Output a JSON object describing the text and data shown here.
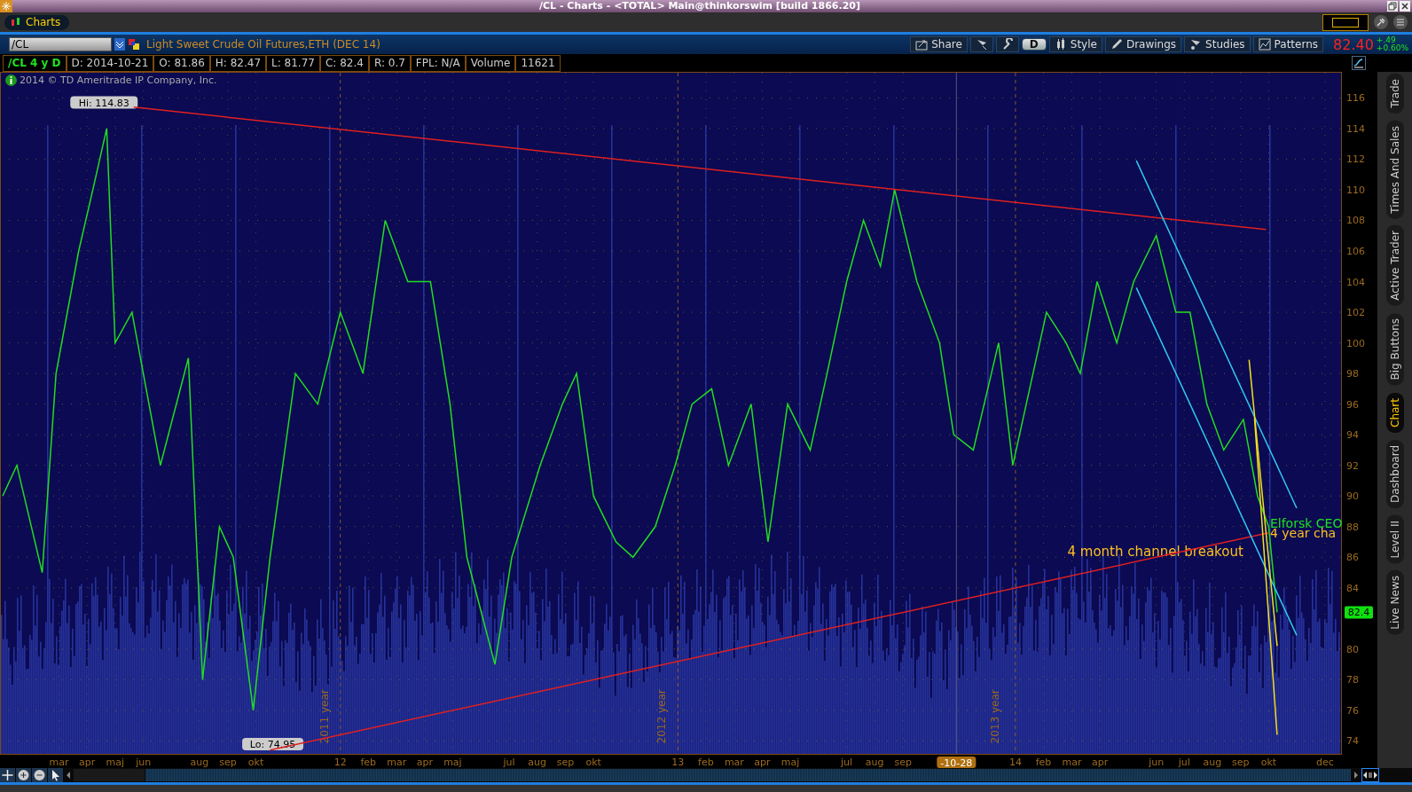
{
  "window": {
    "title": "/CL - Charts - <TOTAL> Main@thinkorswim [build 1866.20]"
  },
  "tabs": [
    {
      "label": "Charts",
      "selected": true
    }
  ],
  "symbol": {
    "value": "/CL",
    "description": "Light Sweet Crude Oil Futures,ETH (DEC 14)"
  },
  "toolbar": [
    {
      "kind": "labeled",
      "label": "Share"
    },
    {
      "kind": "icon"
    },
    {
      "kind": "icon"
    },
    {
      "kind": "period",
      "label": "D"
    },
    {
      "kind": "labeled",
      "label": "Style"
    },
    {
      "kind": "labeled",
      "label": "Drawings"
    },
    {
      "kind": "labeled",
      "label": "Studies"
    },
    {
      "kind": "labeled",
      "label": "Patterns"
    }
  ],
  "quote": {
    "last": "82.40",
    "change": "+.49",
    "change_pct": "+0.60%"
  },
  "info_bar": [
    {
      "kind": "symbol",
      "text": "/CL 4 y D"
    },
    {
      "kind": "field",
      "text": "D: 2014-10-21"
    },
    {
      "kind": "field",
      "text": "O: 81.86"
    },
    {
      "kind": "field",
      "text": "H: 82.47"
    },
    {
      "kind": "field",
      "text": "L: 81.77"
    },
    {
      "kind": "field",
      "text": "C: 82.4"
    },
    {
      "kind": "field",
      "text": "R: 0.7"
    },
    {
      "kind": "field",
      "text": "FPL: N/A"
    },
    {
      "kind": "field",
      "text": "Volume"
    },
    {
      "kind": "field",
      "text": "11621"
    }
  ],
  "copyright": "2014 © TD Ameritrade IP Company, Inc.",
  "chart_data": {
    "type": "line",
    "xlim": [
      10.992,
      14.967
    ],
    "ylim": [
      73.1,
      117.7
    ],
    "x": [
      11.0,
      11.042,
      11.117,
      11.158,
      11.225,
      11.267,
      11.308,
      11.333,
      11.383,
      11.467,
      11.55,
      11.592,
      11.642,
      11.683,
      11.742,
      11.792,
      11.867,
      11.933,
      12.0,
      12.067,
      12.133,
      12.2,
      12.267,
      12.325,
      12.375,
      12.458,
      12.508,
      12.592,
      12.658,
      12.7,
      12.75,
      12.817,
      12.867,
      12.933,
      12.992,
      13.042,
      13.1,
      13.15,
      13.217,
      13.267,
      13.325,
      13.392,
      13.442,
      13.5,
      13.55,
      13.6,
      13.642,
      13.708,
      13.775,
      13.817,
      13.875,
      13.95,
      13.992,
      14.042,
      14.092,
      14.15,
      14.192,
      14.242,
      14.3,
      14.35,
      14.417,
      14.475,
      14.517,
      14.567,
      14.617,
      14.675,
      14.717,
      14.75,
      14.775
    ],
    "series": [
      {
        "color": "#22dd22",
        "values": [
          90,
          92,
          85,
          98,
          106,
          110,
          114,
          100,
          102,
          92,
          99,
          78,
          88,
          86,
          76,
          86,
          98,
          96,
          102,
          98,
          108,
          104,
          104,
          96,
          86,
          79,
          86,
          92,
          96,
          98,
          90,
          87,
          86,
          88,
          92,
          96,
          97,
          92,
          96,
          87,
          96,
          93,
          98,
          104,
          108,
          105,
          110,
          104,
          100,
          94,
          93,
          100,
          92,
          97,
          102,
          100,
          98,
          104,
          100,
          104,
          107,
          102,
          102,
          96,
          93,
          95,
          90,
          88,
          82.4
        ]
      }
    ],
    "xticks": [
      {
        "value": 11.167,
        "label": "mar"
      },
      {
        "value": 11.25,
        "label": "apr"
      },
      {
        "value": 11.333,
        "label": "maj"
      },
      {
        "value": 11.417,
        "label": "jun"
      },
      {
        "value": 11.583,
        "label": "aug"
      },
      {
        "value": 11.667,
        "label": "sep"
      },
      {
        "value": 11.75,
        "label": "okt"
      },
      {
        "value": 12,
        "label": "12"
      },
      {
        "value": 12.083,
        "label": "feb"
      },
      {
        "value": 12.167,
        "label": "mar"
      },
      {
        "value": 12.25,
        "label": "apr"
      },
      {
        "value": 12.333,
        "label": "maj"
      },
      {
        "value": 12.5,
        "label": "jul"
      },
      {
        "value": 12.583,
        "label": "aug"
      },
      {
        "value": 12.667,
        "label": "sep"
      },
      {
        "value": 12.75,
        "label": "okt"
      },
      {
        "value": 13,
        "label": "13"
      },
      {
        "value": 13.083,
        "label": "feb"
      },
      {
        "value": 13.167,
        "label": "mar"
      },
      {
        "value": 13.25,
        "label": "apr"
      },
      {
        "value": 13.333,
        "label": "maj"
      },
      {
        "value": 13.5,
        "label": "jul"
      },
      {
        "value": 13.583,
        "label": "aug"
      },
      {
        "value": 13.667,
        "label": "sep"
      },
      {
        "value": 14,
        "label": "14"
      },
      {
        "value": 14.083,
        "label": "feb"
      },
      {
        "value": 14.167,
        "label": "mar"
      },
      {
        "value": 14.25,
        "label": "apr"
      },
      {
        "value": 14.417,
        "label": "jun"
      },
      {
        "value": 14.5,
        "label": "jul"
      },
      {
        "value": 14.583,
        "label": "aug"
      },
      {
        "value": 14.667,
        "label": "sep"
      },
      {
        "value": 14.75,
        "label": "okt"
      },
      {
        "value": 14.917,
        "label": "dec"
      }
    ],
    "yticks": [
      74,
      76,
      78,
      80,
      84,
      86,
      88,
      90,
      92,
      94,
      96,
      98,
      100,
      102,
      104,
      106,
      108,
      110,
      112,
      114,
      116
    ],
    "grid": true,
    "annotations": [
      "Hi: 114.83",
      "Lo: 74.95",
      "Elforsk CEO",
      "4 year cha",
      "4 month channel breakout",
      "2011 year",
      "2012 year",
      "2013 year"
    ]
  },
  "cursor_label": "-10-28",
  "last_price_tag": "82.4",
  "side_tabs": [
    {
      "label": "Trade",
      "selected": false
    },
    {
      "label": "Times And Sales",
      "selected": false
    },
    {
      "label": "Active Trader",
      "selected": false
    },
    {
      "label": "Big Buttons",
      "selected": false
    },
    {
      "label": "Chart",
      "selected": true
    },
    {
      "label": "Dashboard",
      "selected": false
    },
    {
      "label": "Level II",
      "selected": false
    },
    {
      "label": "Live News",
      "selected": false
    }
  ]
}
